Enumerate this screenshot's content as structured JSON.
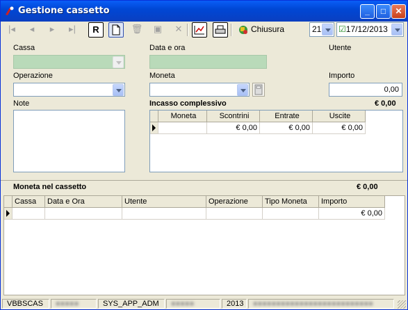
{
  "window": {
    "title": "Gestione cassetto",
    "minimize": "_",
    "maximize": "□",
    "close": "✕"
  },
  "toolbar": {
    "btn_r": "R",
    "chiusura_label": "Chiusura Cassa",
    "number_value": "21",
    "date_value": "17/12/2013",
    "date_checked": "☑"
  },
  "form": {
    "cassa_label": "Cassa",
    "data_ora_label": "Data e ora",
    "utente_label": "Utente",
    "operazione_label": "Operazione",
    "moneta_label": "Moneta",
    "importo_label": "Importo",
    "importo_value": "0,00",
    "note_label": "Note",
    "incasso_label": "Incasso complessivo",
    "incasso_value": "€ 0,00"
  },
  "incasso_grid": {
    "headers": [
      "Moneta",
      "Scontrini",
      "Entrate",
      "Uscite"
    ],
    "row": [
      "",
      "€ 0,00",
      "€ 0,00",
      "€ 0,00"
    ]
  },
  "cassetto": {
    "label": "Moneta nel cassetto",
    "value": "€ 0,00",
    "headers": [
      "Cassa",
      "Data e Ora",
      "Utente",
      "Operazione",
      "Tipo Moneta",
      "Importo"
    ],
    "row": [
      "",
      "",
      "",
      "",
      "",
      "€ 0,00"
    ]
  },
  "status": {
    "s1": "VBBSCAS",
    "s2": "●●●●●",
    "s3": "SYS_APP_ADM",
    "s4": "●●●●●",
    "s5": "2013",
    "s6": "●●●●●●●●●●●●●●●●●●●●●●●●●●"
  }
}
